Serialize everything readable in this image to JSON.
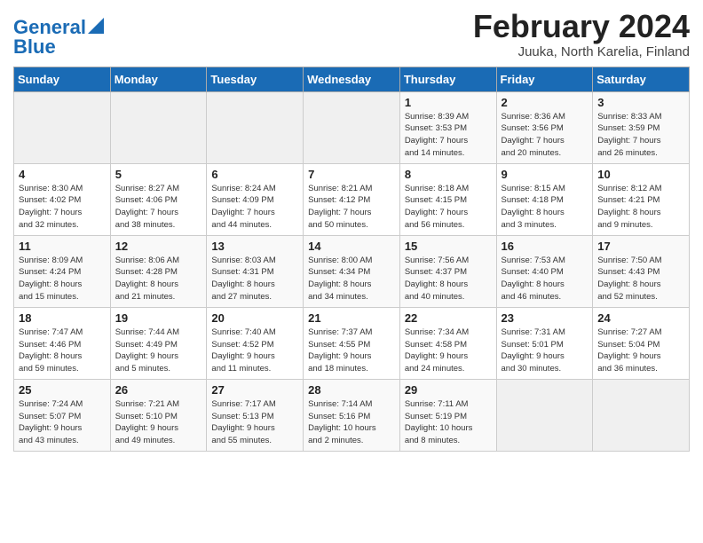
{
  "header": {
    "logo_line1": "General",
    "logo_line2": "Blue",
    "month": "February 2024",
    "location": "Juuka, North Karelia, Finland"
  },
  "weekdays": [
    "Sunday",
    "Monday",
    "Tuesday",
    "Wednesday",
    "Thursday",
    "Friday",
    "Saturday"
  ],
  "weeks": [
    [
      {
        "day": "",
        "info": ""
      },
      {
        "day": "",
        "info": ""
      },
      {
        "day": "",
        "info": ""
      },
      {
        "day": "",
        "info": ""
      },
      {
        "day": "1",
        "info": "Sunrise: 8:39 AM\nSunset: 3:53 PM\nDaylight: 7 hours\nand 14 minutes."
      },
      {
        "day": "2",
        "info": "Sunrise: 8:36 AM\nSunset: 3:56 PM\nDaylight: 7 hours\nand 20 minutes."
      },
      {
        "day": "3",
        "info": "Sunrise: 8:33 AM\nSunset: 3:59 PM\nDaylight: 7 hours\nand 26 minutes."
      }
    ],
    [
      {
        "day": "4",
        "info": "Sunrise: 8:30 AM\nSunset: 4:02 PM\nDaylight: 7 hours\nand 32 minutes."
      },
      {
        "day": "5",
        "info": "Sunrise: 8:27 AM\nSunset: 4:06 PM\nDaylight: 7 hours\nand 38 minutes."
      },
      {
        "day": "6",
        "info": "Sunrise: 8:24 AM\nSunset: 4:09 PM\nDaylight: 7 hours\nand 44 minutes."
      },
      {
        "day": "7",
        "info": "Sunrise: 8:21 AM\nSunset: 4:12 PM\nDaylight: 7 hours\nand 50 minutes."
      },
      {
        "day": "8",
        "info": "Sunrise: 8:18 AM\nSunset: 4:15 PM\nDaylight: 7 hours\nand 56 minutes."
      },
      {
        "day": "9",
        "info": "Sunrise: 8:15 AM\nSunset: 4:18 PM\nDaylight: 8 hours\nand 3 minutes."
      },
      {
        "day": "10",
        "info": "Sunrise: 8:12 AM\nSunset: 4:21 PM\nDaylight: 8 hours\nand 9 minutes."
      }
    ],
    [
      {
        "day": "11",
        "info": "Sunrise: 8:09 AM\nSunset: 4:24 PM\nDaylight: 8 hours\nand 15 minutes."
      },
      {
        "day": "12",
        "info": "Sunrise: 8:06 AM\nSunset: 4:28 PM\nDaylight: 8 hours\nand 21 minutes."
      },
      {
        "day": "13",
        "info": "Sunrise: 8:03 AM\nSunset: 4:31 PM\nDaylight: 8 hours\nand 27 minutes."
      },
      {
        "day": "14",
        "info": "Sunrise: 8:00 AM\nSunset: 4:34 PM\nDaylight: 8 hours\nand 34 minutes."
      },
      {
        "day": "15",
        "info": "Sunrise: 7:56 AM\nSunset: 4:37 PM\nDaylight: 8 hours\nand 40 minutes."
      },
      {
        "day": "16",
        "info": "Sunrise: 7:53 AM\nSunset: 4:40 PM\nDaylight: 8 hours\nand 46 minutes."
      },
      {
        "day": "17",
        "info": "Sunrise: 7:50 AM\nSunset: 4:43 PM\nDaylight: 8 hours\nand 52 minutes."
      }
    ],
    [
      {
        "day": "18",
        "info": "Sunrise: 7:47 AM\nSunset: 4:46 PM\nDaylight: 8 hours\nand 59 minutes."
      },
      {
        "day": "19",
        "info": "Sunrise: 7:44 AM\nSunset: 4:49 PM\nDaylight: 9 hours\nand 5 minutes."
      },
      {
        "day": "20",
        "info": "Sunrise: 7:40 AM\nSunset: 4:52 PM\nDaylight: 9 hours\nand 11 minutes."
      },
      {
        "day": "21",
        "info": "Sunrise: 7:37 AM\nSunset: 4:55 PM\nDaylight: 9 hours\nand 18 minutes."
      },
      {
        "day": "22",
        "info": "Sunrise: 7:34 AM\nSunset: 4:58 PM\nDaylight: 9 hours\nand 24 minutes."
      },
      {
        "day": "23",
        "info": "Sunrise: 7:31 AM\nSunset: 5:01 PM\nDaylight: 9 hours\nand 30 minutes."
      },
      {
        "day": "24",
        "info": "Sunrise: 7:27 AM\nSunset: 5:04 PM\nDaylight: 9 hours\nand 36 minutes."
      }
    ],
    [
      {
        "day": "25",
        "info": "Sunrise: 7:24 AM\nSunset: 5:07 PM\nDaylight: 9 hours\nand 43 minutes."
      },
      {
        "day": "26",
        "info": "Sunrise: 7:21 AM\nSunset: 5:10 PM\nDaylight: 9 hours\nand 49 minutes."
      },
      {
        "day": "27",
        "info": "Sunrise: 7:17 AM\nSunset: 5:13 PM\nDaylight: 9 hours\nand 55 minutes."
      },
      {
        "day": "28",
        "info": "Sunrise: 7:14 AM\nSunset: 5:16 PM\nDaylight: 10 hours\nand 2 minutes."
      },
      {
        "day": "29",
        "info": "Sunrise: 7:11 AM\nSunset: 5:19 PM\nDaylight: 10 hours\nand 8 minutes."
      },
      {
        "day": "",
        "info": ""
      },
      {
        "day": "",
        "info": ""
      }
    ]
  ]
}
